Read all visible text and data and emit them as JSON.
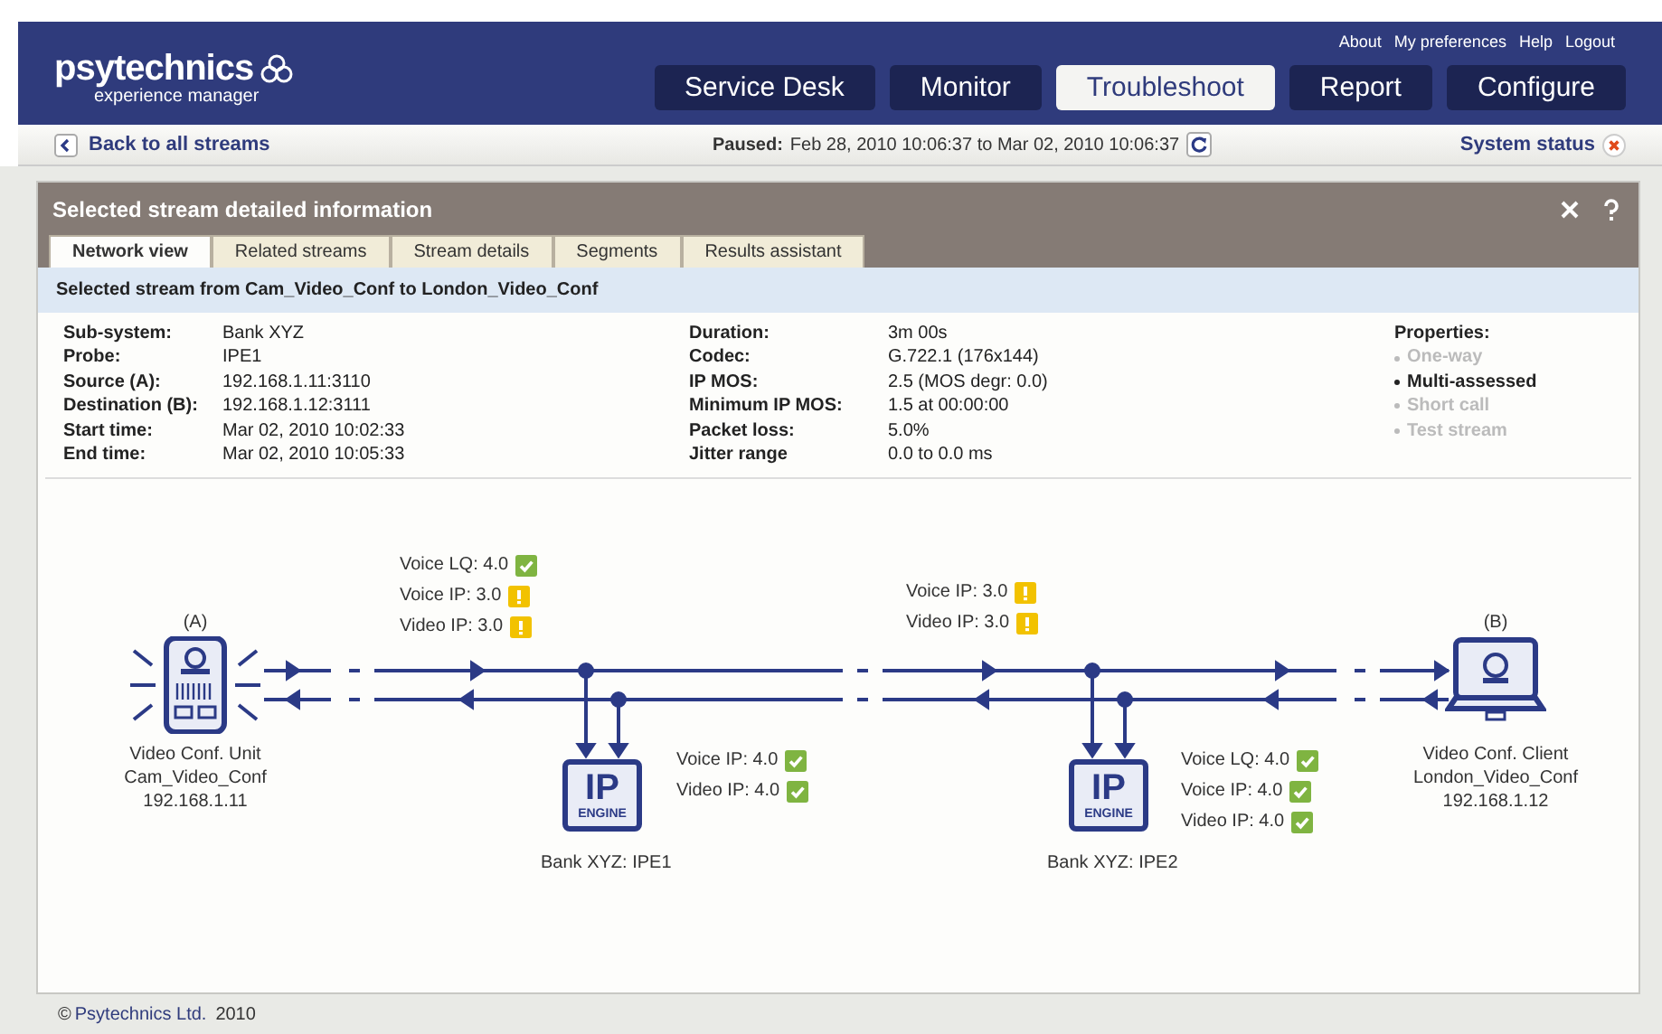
{
  "header": {
    "logo": {
      "name": "psytechnics",
      "tagline": "experience manager"
    },
    "top_links": [
      "About",
      "My preferences",
      "Help",
      "Logout"
    ],
    "nav": [
      {
        "label": "Service Desk",
        "selected": false
      },
      {
        "label": "Monitor",
        "selected": false
      },
      {
        "label": "Troubleshoot",
        "selected": true
      },
      {
        "label": "Report",
        "selected": false
      },
      {
        "label": "Configure",
        "selected": false
      }
    ]
  },
  "toolbar": {
    "back_link": "Back to all streams",
    "paused_label": "Paused:",
    "paused_range": "Feb 28, 2010 10:06:37 to Mar 02, 2010 10:06:37",
    "system_status": "System status"
  },
  "panel": {
    "title": "Selected stream detailed information",
    "tabs": [
      {
        "label": "Network view",
        "selected": true
      },
      {
        "label": "Related streams",
        "selected": false
      },
      {
        "label": "Stream details",
        "selected": false
      },
      {
        "label": "Segments",
        "selected": false
      },
      {
        "label": "Results assistant",
        "selected": false
      }
    ],
    "stream_heading": "Selected stream from Cam_Video_Conf to London_Video_Conf",
    "details_left": [
      {
        "label": "Sub-system:",
        "value": "Bank XYZ"
      },
      {
        "label": "Probe:",
        "value": "IPE1"
      },
      {
        "label": "Source (A):",
        "value": "192.168.1.11:3110"
      },
      {
        "label": "Destination (B):",
        "value": "192.168.1.12:3111"
      },
      {
        "label": "Start time:",
        "value": "Mar 02, 2010 10:02:33"
      },
      {
        "label": "End time:",
        "value": "Mar 02, 2010 10:05:33"
      }
    ],
    "details_mid": [
      {
        "label": "Duration:",
        "value": "3m 00s"
      },
      {
        "label": "Codec:",
        "value": "G.722.1 (176x144)"
      },
      {
        "label": "IP MOS:",
        "value": "2.5 (MOS degr: 0.0)"
      },
      {
        "label": "Minimum IP MOS:",
        "value": "1.5 at 00:00:00"
      },
      {
        "label": "Packet loss:",
        "value": "5.0%"
      },
      {
        "label": "Jitter range",
        "value": "0.0 to 0.0 ms"
      }
    ],
    "properties": {
      "title": "Properties:",
      "items": [
        {
          "label": "One-way",
          "enabled": false
        },
        {
          "label": "Multi-assessed",
          "enabled": true
        },
        {
          "label": "Short call",
          "enabled": false
        },
        {
          "label": "Test stream",
          "enabled": false
        }
      ]
    }
  },
  "diagram": {
    "endpoints": [
      {
        "kind": "unit",
        "tag": "(A)",
        "lines": [
          "Video Conf. Unit",
          "Cam_Video_Conf",
          "192.168.1.11"
        ]
      },
      {
        "kind": "laptop",
        "tag": "(B)",
        "lines": [
          "Video Conf. Client",
          "London_Video_Conf",
          "192.168.1.12"
        ]
      }
    ],
    "engines": [
      {
        "label": "IP",
        "sublabel": "ENGINE",
        "caption": "Bank XYZ: IPE1"
      },
      {
        "label": "IP",
        "sublabel": "ENGINE",
        "caption": "Bank XYZ: IPE2"
      }
    ],
    "metric_groups": [
      {
        "rows": [
          {
            "label": "Voice LQ: 4.0",
            "kind": "ok"
          },
          {
            "label": "Voice IP: 3.0",
            "kind": "warn"
          },
          {
            "label": "Video IP: 3.0",
            "kind": "warn"
          }
        ]
      },
      {
        "rows": [
          {
            "label": "Voice IP: 4.0",
            "kind": "ok"
          },
          {
            "label": "Video IP: 4.0",
            "kind": "ok"
          }
        ]
      },
      {
        "rows": [
          {
            "label": "Voice IP: 3.0",
            "kind": "warn"
          },
          {
            "label": "Video IP: 3.0",
            "kind": "warn"
          }
        ]
      },
      {
        "rows": [
          {
            "label": "Voice LQ: 4.0",
            "kind": "ok"
          },
          {
            "label": "Voice IP: 4.0",
            "kind": "ok"
          },
          {
            "label": "Video IP: 4.0",
            "kind": "ok"
          }
        ]
      }
    ]
  },
  "footer": {
    "symbol": "©",
    "company": "Psytechnics Ltd.",
    "year": "2010"
  }
}
